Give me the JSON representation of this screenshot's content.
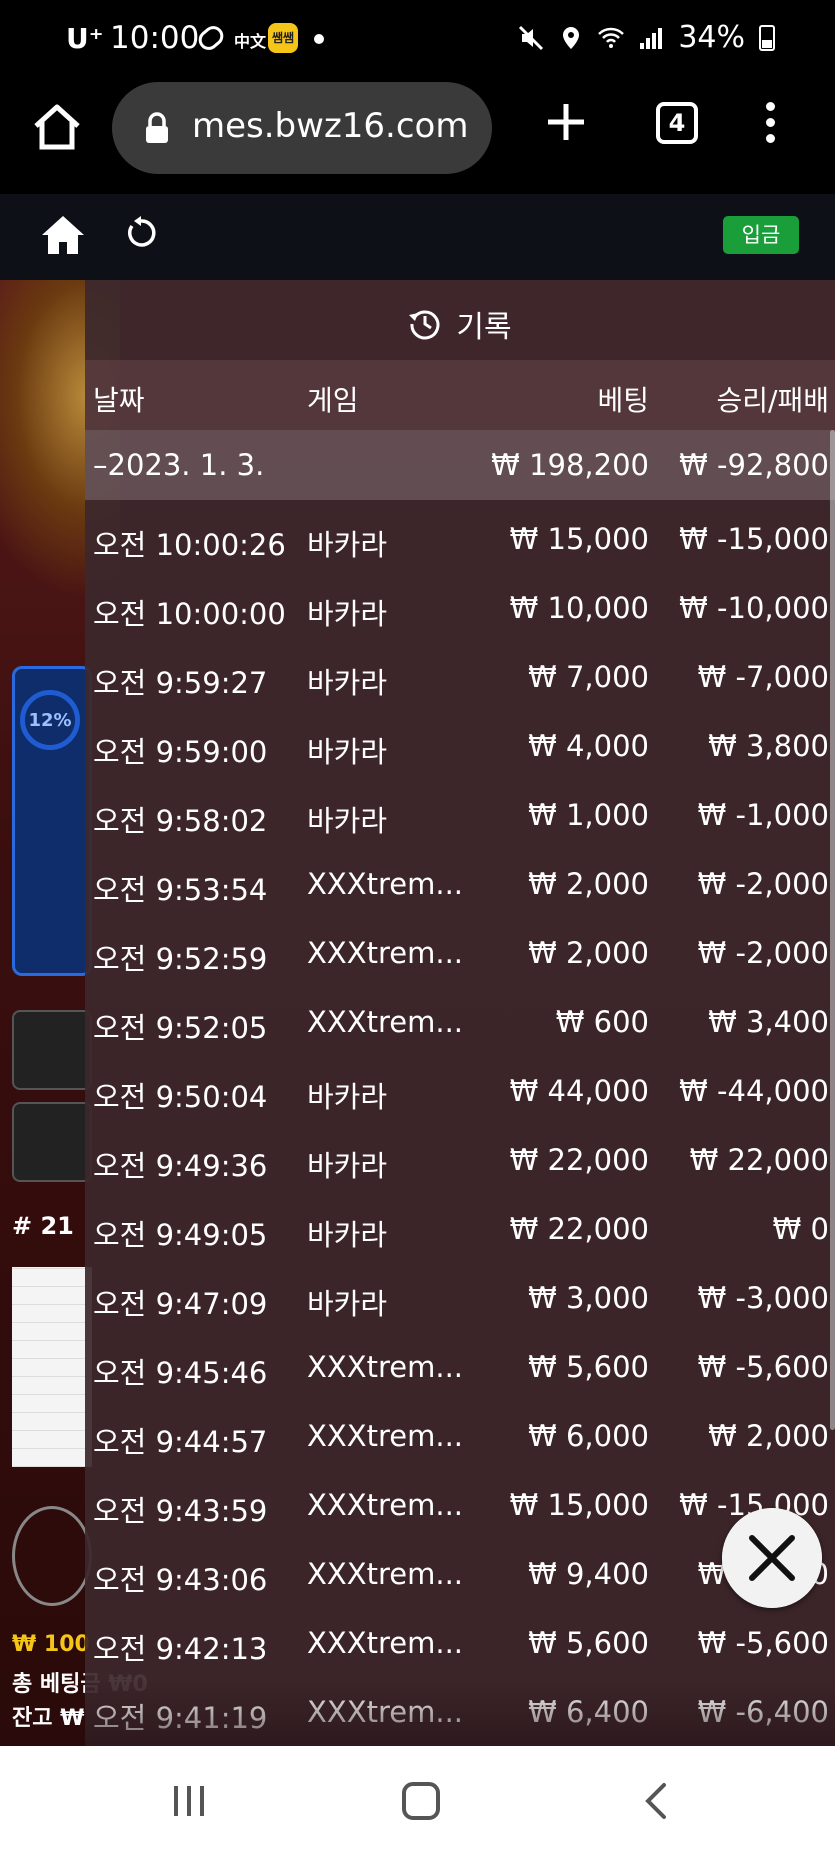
{
  "status_bar": {
    "carrier": "U⁺",
    "time": "10:00",
    "lang_icon": "中文",
    "notification_badge": "쌤쌤",
    "battery": "34%"
  },
  "browser": {
    "url": "mes.bwz16.com",
    "tab_count": "4"
  },
  "game_header": {
    "deposit_label": "입금"
  },
  "background": {
    "percent": "12%",
    "round": "# 21",
    "balance_line1": "₩ 100",
    "balance_line2": "총 베팅금 ₩0",
    "balance_line3": "잔고 ₩"
  },
  "history": {
    "title": "기록",
    "headers": {
      "date": "날짜",
      "game": "게임",
      "bet": "베팅",
      "result": "승리/패배"
    },
    "summary": {
      "date": "–2023. 1. 3.",
      "bet": "₩ 198,200",
      "result": "₩ -92,800"
    },
    "rows": [
      {
        "time": "오전 10:00:26",
        "game": "바카라",
        "bet": "₩ 15,000",
        "result": "₩ -15,000"
      },
      {
        "time": "오전 10:00:00",
        "game": "바카라",
        "bet": "₩ 10,000",
        "result": "₩ -10,000"
      },
      {
        "time": "오전 9:59:27",
        "game": "바카라",
        "bet": "₩ 7,000",
        "result": "₩ -7,000"
      },
      {
        "time": "오전 9:59:00",
        "game": "바카라",
        "bet": "₩ 4,000",
        "result": "₩ 3,800"
      },
      {
        "time": "오전 9:58:02",
        "game": "바카라",
        "bet": "₩ 1,000",
        "result": "₩ -1,000"
      },
      {
        "time": "오전 9:53:54",
        "game": "XXXtrem...",
        "bet": "₩ 2,000",
        "result": "₩ -2,000"
      },
      {
        "time": "오전 9:52:59",
        "game": "XXXtrem...",
        "bet": "₩ 2,000",
        "result": "₩ -2,000"
      },
      {
        "time": "오전 9:52:05",
        "game": "XXXtrem...",
        "bet": "₩ 600",
        "result": "₩ 3,400"
      },
      {
        "time": "오전 9:50:04",
        "game": "바카라",
        "bet": "₩ 44,000",
        "result": "₩ -44,000"
      },
      {
        "time": "오전 9:49:36",
        "game": "바카라",
        "bet": "₩ 22,000",
        "result": "₩ 22,000"
      },
      {
        "time": "오전 9:49:05",
        "game": "바카라",
        "bet": "₩ 22,000",
        "result": "₩ 0"
      },
      {
        "time": "오전 9:47:09",
        "game": "바카라",
        "bet": "₩ 3,000",
        "result": "₩ -3,000"
      },
      {
        "time": "오전 9:45:46",
        "game": "XXXtrem...",
        "bet": "₩ 5,600",
        "result": "₩ -5,600"
      },
      {
        "time": "오전 9:44:57",
        "game": "XXXtrem...",
        "bet": "₩ 6,000",
        "result": "₩ 2,000"
      },
      {
        "time": "오전 9:43:59",
        "game": "XXXtrem...",
        "bet": "₩ 15,000",
        "result": "₩ -15,000"
      },
      {
        "time": "오전 9:43:06",
        "game": "XXXtrem...",
        "bet": "₩ 9,400",
        "result": "₩ -9,400"
      },
      {
        "time": "오전 9:42:13",
        "game": "XXXtrem...",
        "bet": "₩ 5,600",
        "result": "₩ -5,600"
      },
      {
        "time": "오전 9:41:19",
        "game": "XXXtrem...",
        "bet": "₩ 6,400",
        "result": "₩ -6,400"
      }
    ]
  },
  "colors": {
    "deposit_green": "#1a9e3a",
    "panel_bg": "#3c282c"
  }
}
